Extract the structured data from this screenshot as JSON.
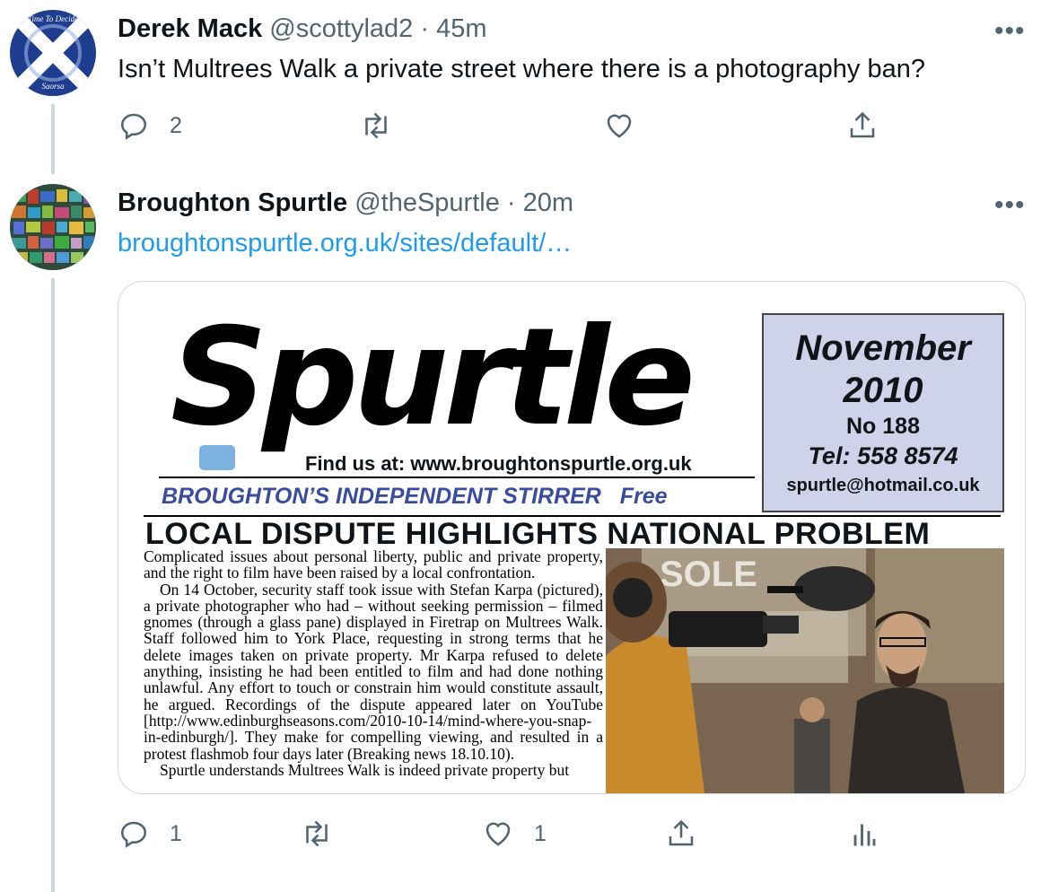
{
  "tweets": [
    {
      "name": "Derek Mack",
      "handle": "@scottylad2",
      "time": "· 45m",
      "text": "Isn’t Multrees Walk a private street where there is a photography ban?",
      "avatar_text": {
        "top": "Time To Decide",
        "bottom": "Saorsa"
      },
      "counts": {
        "reply": "2",
        "retweet": "",
        "like": ""
      }
    },
    {
      "name": "Broughton Spurtle",
      "handle": "@theSpurtle",
      "time": "· 20m",
      "link": "broughtonspurtle.org.uk/sites/default/…",
      "counts": {
        "reply": "1",
        "retweet": "",
        "like": "1"
      }
    }
  ],
  "newspaper": {
    "masthead": "Spurtle",
    "find_us": "Find us at: www.broughtonspurtle.org.uk",
    "tagline": "BROUGHTON’S INDEPENDENT STIRRER",
    "free": "Free",
    "month": "November",
    "year": "2010",
    "issue": "No 188",
    "tel": "Tel: 558 8574",
    "email": "spurtle@hotmail.co.uk",
    "headline": "LOCAL DISPUTE HIGHLIGHTS NATIONAL PROBLEM",
    "paragraph1": "Complicated issues about personal liberty, public and private property, and the right to film have been raised by a local confrontation.",
    "paragraph2": "On 14 October, security staff took issue with Stefan Karpa (pictured), a private photographer who had – without seeking permission – filmed gnomes (through a glass pane) displayed in Firetrap on Multrees Walk. Staff followed him to York Place, requesting in strong terms that he delete images taken on private property. Mr Karpa refused to delete anything, insisting he had been entitled to film and had done nothing unlawful. Any effort to touch or constrain him would constitute assault, he argued. Recordings of the dispute appeared later on YouTube [http://www.edinburghseasons.com/2010-10-14/mind-where-you-snap-in-edinburgh/]. They make for compelling viewing, and resulted in a protest flashmob four days later (Breaking news 18.10.10).",
    "paragraph3": "Spurtle understands Multrees Walk is indeed private property but",
    "photo_sign": "SOLE"
  },
  "colors": {
    "link": "#1d9bf0",
    "secondary": "#536471",
    "thread": "#cfd9de"
  },
  "icons": [
    "reply-icon",
    "retweet-icon",
    "like-icon",
    "share-icon",
    "analytics-icon",
    "more-icon"
  ]
}
